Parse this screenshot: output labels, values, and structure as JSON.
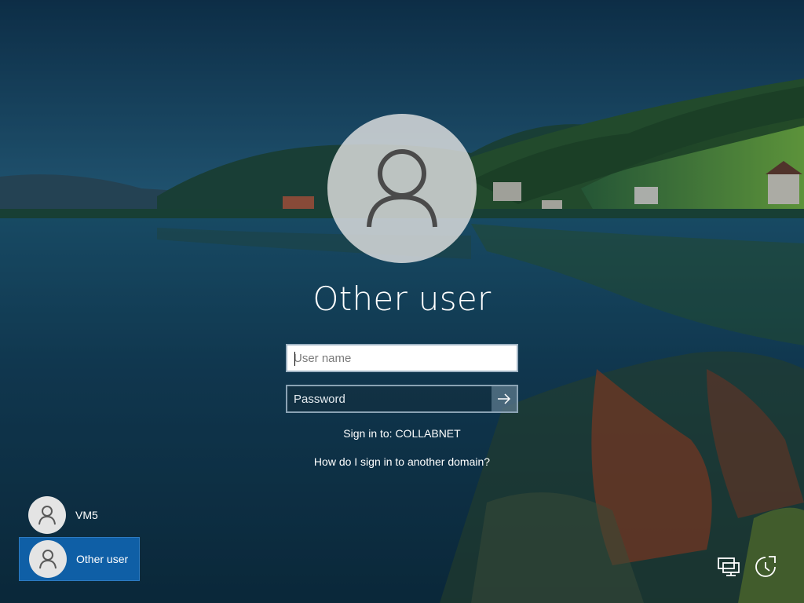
{
  "login": {
    "user_title": "Other user",
    "username_placeholder": "User name",
    "password_placeholder": "Password",
    "sign_in_to": "Sign in to: COLLABNET",
    "domain_help_link": "How do I sign in to another domain?"
  },
  "user_list": [
    {
      "name": "VM5",
      "selected": false
    },
    {
      "name": "Other user",
      "selected": true
    }
  ],
  "corner_icons": [
    "network-icon",
    "ease-of-access-icon"
  ],
  "colors": {
    "selected_tile": "#0f5fa6",
    "text": "#ffffff"
  }
}
